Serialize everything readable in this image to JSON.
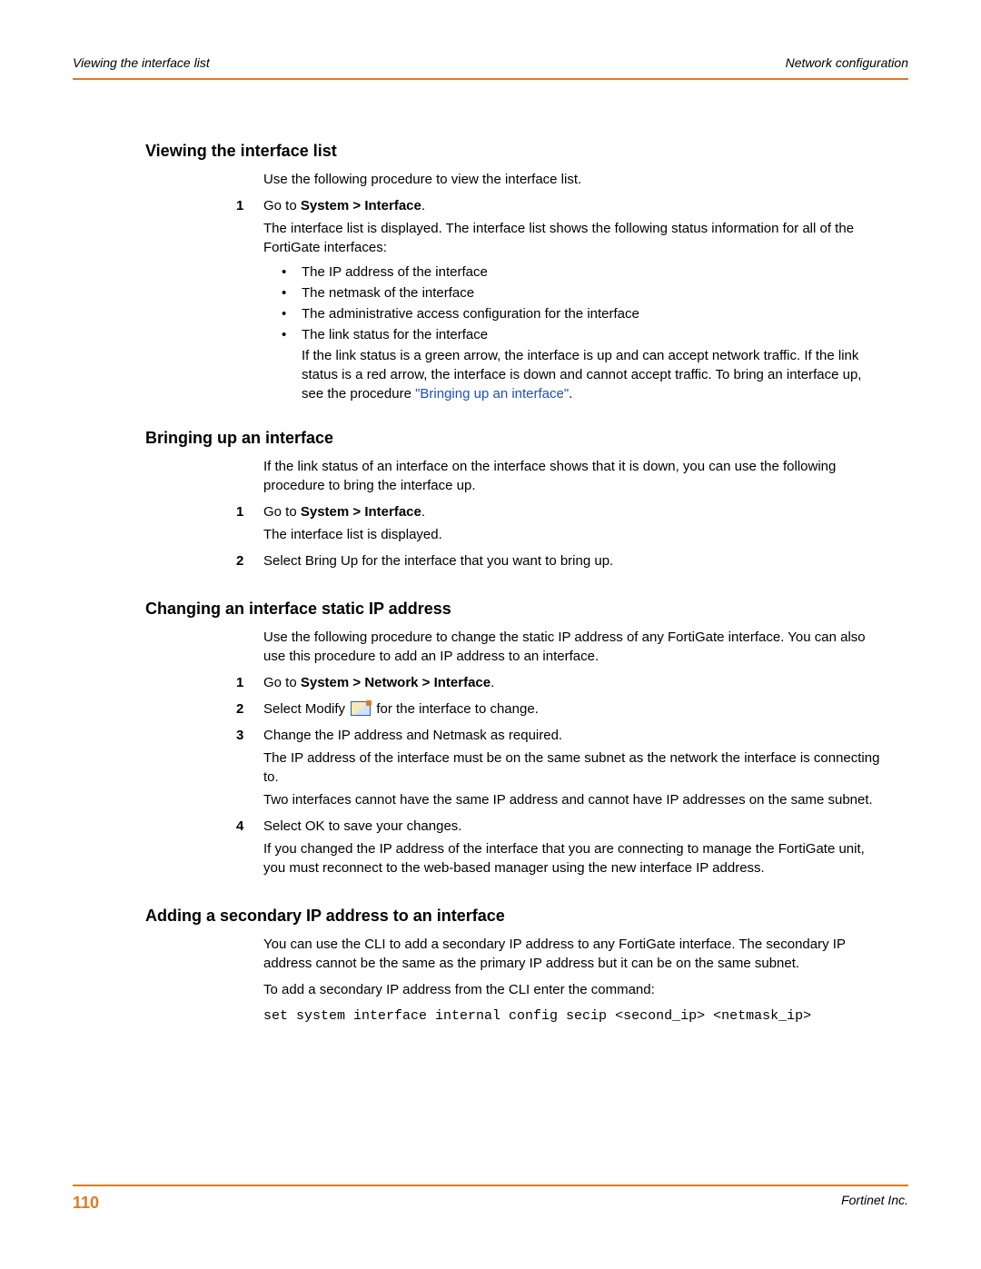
{
  "header": {
    "left": "Viewing the interface list",
    "right": "Network configuration"
  },
  "footer": {
    "pageno": "110",
    "vendor": "Fortinet Inc."
  },
  "sec1": {
    "title": "Viewing the interface list",
    "lead": "Use the following procedure to view the interface list.",
    "step1_goto_pre": "Go to ",
    "step1_goto_bold": "System > Interface",
    "step1_p": "The interface list is displayed. The interface list shows the following status information for all of the FortiGate interfaces:",
    "b1": "The IP address of the interface",
    "b2": "The netmask of the interface",
    "b3": "The administrative access configuration for the interface",
    "b4": "The link status for the interface",
    "b4_sub_pre": "If the link status is a green arrow, the interface is up and can accept network traffic. If the link status is a red arrow, the interface is down and cannot accept traffic. To bring an interface up, see the procedure ",
    "b4_link": "\"Bringing up an interface\""
  },
  "sec2": {
    "title": "Bringing up an interface",
    "lead": "If the link status of an interface on the interface shows that it is down, you can use the following procedure to bring the interface up.",
    "step1_goto_pre": "Go to ",
    "step1_goto_bold": "System > Interface",
    "step1_p": "The interface list is displayed.",
    "step2": "Select Bring Up for the interface that you want to bring up."
  },
  "sec3": {
    "title": "Changing an interface static IP address",
    "lead": "Use the following procedure to change the static IP address of any FortiGate interface. You can also use this procedure to add an IP address to an interface.",
    "step1_goto_pre": "Go to ",
    "step1_goto_bold": "System > Network > Interface",
    "step2_pre": "Select Modify ",
    "step2_post": " for the interface to change.",
    "step3_a": "Change the IP address and Netmask as required.",
    "step3_b": "The IP address of the interface must be on the same subnet as the network the interface is connecting to.",
    "step3_c": "Two interfaces cannot have the same IP address and cannot have IP addresses on the same subnet.",
    "step4_a": "Select OK to save your changes.",
    "step4_b": "If you changed the IP address of the interface that you are connecting to manage the FortiGate unit, you must reconnect to the web-based manager using the new interface IP address."
  },
  "sec4": {
    "title": "Adding a secondary IP address to an interface",
    "p1": "You can use the CLI to add a secondary IP address to any FortiGate interface. The secondary IP address cannot be the same as the primary IP address but it can be on the same subnet.",
    "p2": "To add a secondary IP address from the CLI enter the command:",
    "cmd": "set system interface internal config secip <second_ip> <netmask_ip>"
  },
  "nums": {
    "n1": "1",
    "n2": "2",
    "n3": "3",
    "n4": "4"
  },
  "dot": "•",
  "period": "."
}
